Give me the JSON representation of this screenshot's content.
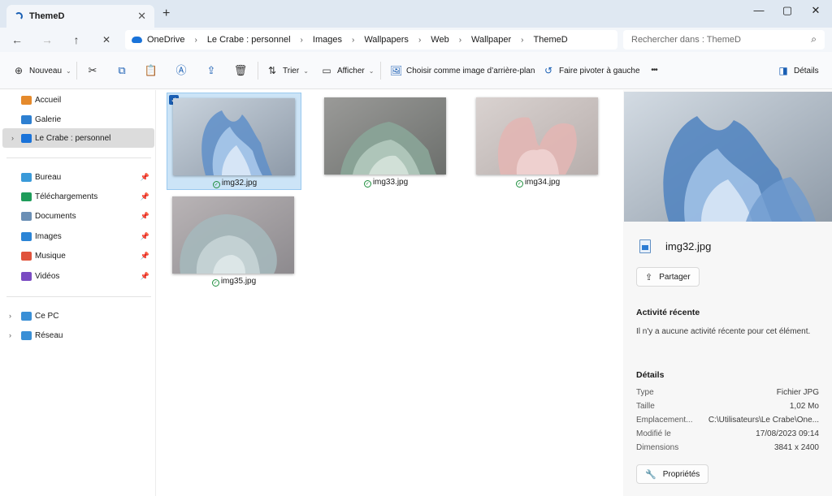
{
  "window": {
    "tab_title": "ThemeD",
    "tab_close": "✕",
    "new_tab": "+",
    "minimize": "—",
    "maximize": "▢",
    "close": "✕"
  },
  "nav": {
    "back": "←",
    "forward": "→",
    "up": "↑",
    "stop": "✕",
    "breadcrumb": [
      "OneDrive",
      "Le Crabe : personnel",
      "Images",
      "Wallpapers",
      "Web",
      "Wallpaper",
      "ThemeD"
    ],
    "separator": "›",
    "search_placeholder": "Rechercher dans : ThemeD",
    "search_icon": "⌕"
  },
  "toolbar": {
    "new_label": "Nouveau",
    "sort_label": "Trier",
    "view_label": "Afficher",
    "set_background_label": "Choisir comme image d’arrière-plan",
    "rotate_left_label": "Faire pivoter à gauche",
    "more": "•••",
    "details_label": "Détails"
  },
  "sidebar": {
    "quick": [
      {
        "label": "Accueil",
        "color": "#e58a2c"
      },
      {
        "label": "Galerie",
        "color": "#2d7fd1"
      },
      {
        "label": "Le Crabe : personnel",
        "color": "#1a73d9"
      }
    ],
    "pinned": [
      {
        "label": "Bureau",
        "color": "#3a9ad9"
      },
      {
        "label": "Téléchargements",
        "color": "#1e9c5a"
      },
      {
        "label": "Documents",
        "color": "#6b8fb5"
      },
      {
        "label": "Images",
        "color": "#2a84d6"
      },
      {
        "label": "Musique",
        "color": "#e0533c"
      },
      {
        "label": "Vidéos",
        "color": "#7a4bc2"
      }
    ],
    "bottom": [
      {
        "label": "Ce PC",
        "color": "#3a8fd6"
      },
      {
        "label": "Réseau",
        "color": "#3a8fd6"
      }
    ],
    "pin_glyph": "📌"
  },
  "files": [
    {
      "name": "img32.jpg",
      "selected": true
    },
    {
      "name": "img33.jpg",
      "selected": false
    },
    {
      "name": "img34.jpg",
      "selected": false
    },
    {
      "name": "img35.jpg",
      "selected": false
    }
  ],
  "details": {
    "file_name": "img32.jpg",
    "share_label": "Partager",
    "recent_heading": "Activité récente",
    "recent_text": "Il n'y a aucune activité récente pour cet élément.",
    "details_heading": "Détails",
    "properties": [
      {
        "key": "Type",
        "value": "Fichier JPG"
      },
      {
        "key": "Taille",
        "value": "1,02 Mo"
      },
      {
        "key": "Emplacement...",
        "value": "C:\\Utilisateurs\\Le Crabe\\One..."
      },
      {
        "key": "Modifié le",
        "value": "17/08/2023 09:14"
      },
      {
        "key": "Dimensions",
        "value": "3841 x 2400"
      }
    ],
    "properties_label": "Propriétés"
  }
}
